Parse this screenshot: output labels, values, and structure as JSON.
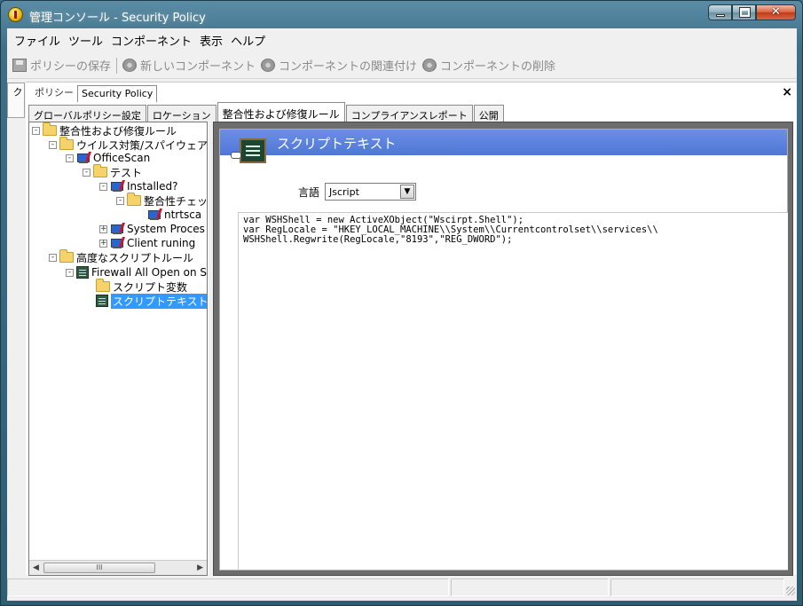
{
  "window": {
    "title": "管理コンソール - Security Policy"
  },
  "menubar": {
    "items": [
      "ファイル",
      "ツール",
      "コンポーネント",
      "表示",
      "ヘルプ"
    ]
  },
  "toolbar": {
    "items": [
      {
        "label": "ポリシーの保存",
        "icon": "save-icon"
      },
      {
        "label": "新しいコンポーネント",
        "icon": "gear-icon"
      },
      {
        "label": "コンポーネントの関連付け",
        "icon": "gear-icon"
      },
      {
        "label": "コンポーネントの削除",
        "icon": "gear-icon"
      }
    ]
  },
  "side_tab": {
    "label": "タスク"
  },
  "doc": {
    "prefix": "ポリシー",
    "tab_label": "Security Policy",
    "close": "×"
  },
  "subtabs": [
    {
      "label": "グローバルポリシー設定",
      "active": false
    },
    {
      "label": "ロケーション",
      "active": false
    },
    {
      "label": "整合性および修復ルール",
      "active": true
    },
    {
      "label": "コンプライアンスレポート",
      "active": false
    },
    {
      "label": "公開",
      "active": false
    }
  ],
  "tree": {
    "nodes": [
      {
        "label": "整合性および修復ルール",
        "icon": "folder",
        "expander": "-"
      },
      {
        "label": "ウイルス対策/スパイウェアル",
        "icon": "folder",
        "expander": "-"
      },
      {
        "label": "OfficeScan",
        "icon": "computer",
        "expander": "-"
      },
      {
        "label": "テスト",
        "icon": "folder",
        "expander": "-"
      },
      {
        "label": "Installed?",
        "icon": "computer",
        "expander": "-"
      },
      {
        "label": "整合性チェッ",
        "icon": "folder",
        "expander": "-"
      },
      {
        "label": "ntrtsca",
        "icon": "check",
        "expander": ""
      },
      {
        "label": "System Proces",
        "icon": "computer",
        "expander": "+"
      },
      {
        "label": "Client runing",
        "icon": "computer",
        "expander": "+"
      },
      {
        "label": "高度なスクリプトルール",
        "icon": "folder",
        "expander": "-"
      },
      {
        "label": "Firewall All Open on St",
        "icon": "script",
        "expander": "-"
      },
      {
        "label": "スクリプト変数",
        "icon": "folder",
        "expander": ""
      },
      {
        "label": "スクリプトテキスト",
        "icon": "script",
        "expander": "",
        "selected": true
      }
    ],
    "scroll_thumb": "III"
  },
  "panel": {
    "title": "スクリプトテキスト",
    "language_label": "言語",
    "language_value": "Jscript",
    "code_lines": [
      "var WSHShell = new ActiveXObject(\"Wscirpt.Shell\");",
      "var RegLocale = \"HKEY_LOCAL_MACHINE\\\\System\\\\Currentcontrolset\\\\services\\\\",
      "WSHShell.Regwrite(RegLocale,\"8193\",\"REG_DWORD\");"
    ]
  },
  "colors": {
    "header_blue": "#5b82dc",
    "selection": "#3399ff",
    "vista_frame": "#3e6f86"
  }
}
